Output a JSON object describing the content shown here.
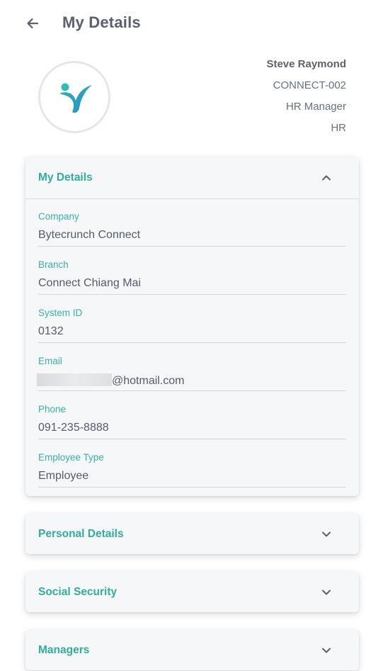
{
  "header": {
    "title": "My Details",
    "back_icon": "arrow-left-icon"
  },
  "profile": {
    "name": "Steve Raymond",
    "employee_code": "CONNECT-002",
    "position": "HR Manager",
    "department": "HR",
    "avatar_icon": "company-logo"
  },
  "colors": {
    "accent": "#2fae9c",
    "text": "#555b66"
  },
  "sections": {
    "my_details": {
      "title": "My Details",
      "expanded": true,
      "chevron": "chevron-up-icon",
      "fields": [
        {
          "label": "Company",
          "value": "Bytecrunch Connect"
        },
        {
          "label": "Branch",
          "value": "Connect Chiang Mai"
        },
        {
          "label": "System ID",
          "value": "0132"
        },
        {
          "label": "Email",
          "value": "@hotmail.com"
        },
        {
          "label": "Phone",
          "value": "091-235-8888"
        },
        {
          "label": "Employee Type",
          "value": "Employee"
        }
      ]
    },
    "personal_details": {
      "title": "Personal Details",
      "expanded": false,
      "chevron": "chevron-down-icon"
    },
    "social_security": {
      "title": "Social Security",
      "expanded": false,
      "chevron": "chevron-down-icon"
    },
    "managers": {
      "title": "Managers",
      "expanded": false,
      "chevron": "chevron-down-icon"
    }
  }
}
